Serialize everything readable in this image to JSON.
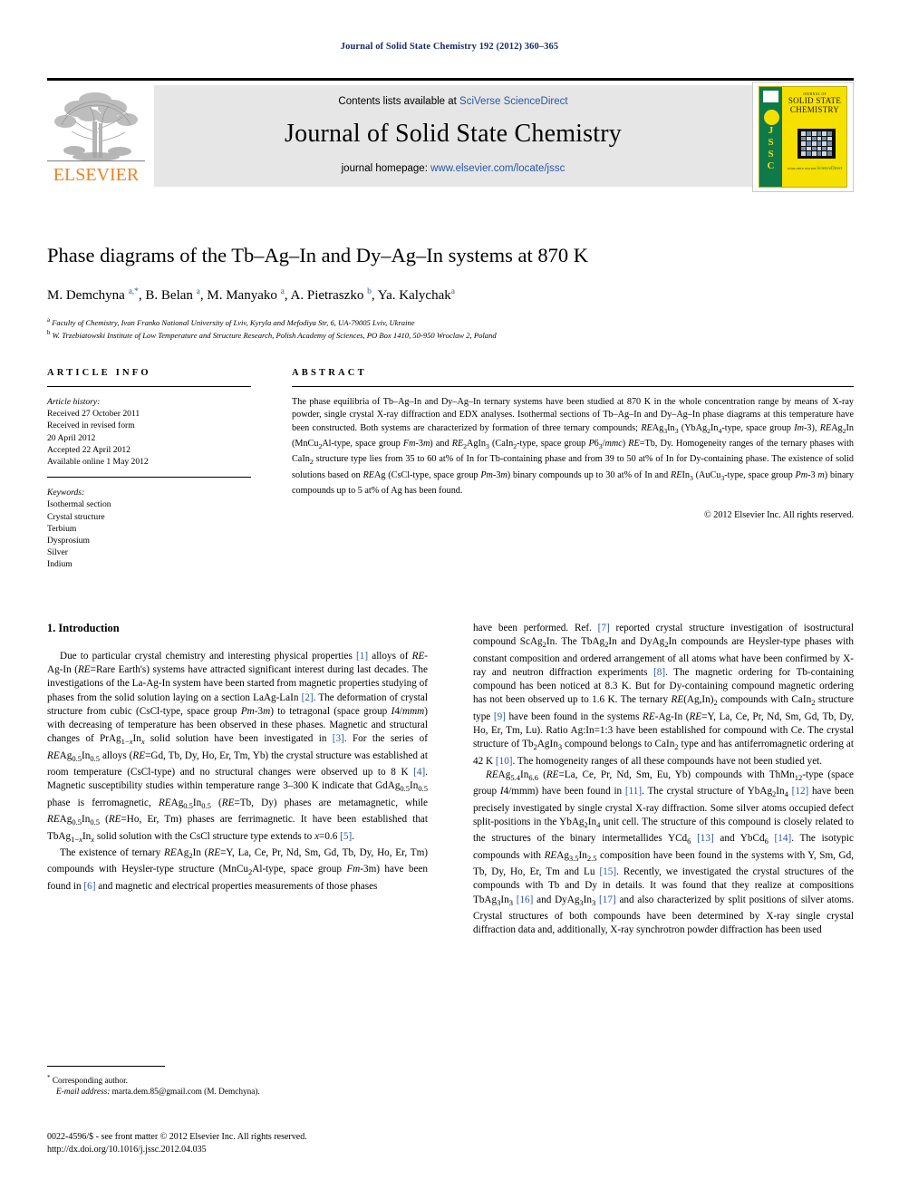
{
  "running_head": "Journal of Solid State Chemistry 192 (2012) 360–365",
  "masthead": {
    "contents_prefix": "Contents lists available at ",
    "contents_link": "SciVerse ScienceDirect",
    "journal_title": "Journal of Solid State Chemistry",
    "homepage_prefix": "journal homepage: ",
    "homepage_link": "www.elsevier.com/locate/jssc",
    "publisher_wordmark": "ELSEVIER"
  },
  "cover": {
    "kicker": "JOURNAL OF",
    "line1": "SOLID STATE",
    "line2": "CHEMISTRY",
    "spine_letters": "J\nS\nS\nC",
    "footer_brand": "ScienceDirect",
    "footer_note": "AVAILABLE ONLINE"
  },
  "article": {
    "title": "Phase diagrams of the Tb–Ag–In and Dy–Ag–In systems at 870 K",
    "authors_html": "M. Demchyna <sup>a,*</sup>, B. Belan <sup>a</sup>, M. Manyako <sup>a</sup>, A. Pietraszko <sup>b</sup>, Ya. Kalychak<sup>a</sup>",
    "affiliation_a": "Faculty of Chemistry, Ivan Franko National University of Lviv, Kyryla and Mefodiya Str, 6, UA-79005 Lviv, Ukraine",
    "affiliation_b": "W. Trzebiatowski Institute of Low Temperature and Structure Research, Polish Academy of Sciences, PO Box 1410, 50-950 Wroclaw 2, Poland"
  },
  "article_info": {
    "heading": "ARTICLE INFO",
    "history_label": "Article history:",
    "history": [
      "Received 27 October 2011",
      "Received in revised form",
      "20 April 2012",
      "Accepted 22 April 2012",
      "Available online 1 May 2012"
    ],
    "keywords_label": "Keywords:",
    "keywords": [
      "Isothermal section",
      "Crystal structure",
      "Terbium",
      "Dysprosium",
      "Silver",
      "Indium"
    ]
  },
  "abstract": {
    "heading": "ABSTRACT",
    "body_html": "The phase equilibria of Tb–Ag–In and Dy–Ag–In ternary systems have been studied at 870 K in the whole concentration range by means of X-ray powder, single crystal X-ray diffraction and EDX analyses. Isothermal sections of Tb–Ag–In and Dy–Ag–In phase diagrams at this temperature have been constructed. Both systems are characterized by formation of three ternary compounds; <i>RE</i>Ag<sub>3</sub>In<sub>3</sub> (YbAg<sub>2</sub>In<sub>4</sub>-type, space group <i>Im</i>-3), <i>RE</i>Ag<sub>2</sub>In (MnCu<sub>2</sub>Al-type, space group <i>Fm</i>-3<i>m</i>) and <i>RE</i><sub>2</sub>AgIn<sub>3</sub> (CaIn<sub>2</sub>-type, space group <i>P</i>6<sub>3</sub>/<i>mmc</i>) <i>RE</i>=Tb, Dy. Homogeneity ranges of the ternary phases with CaIn<sub>2</sub> structure type lies from 35 to 60 at% of In for Tb-containing phase and from 39 to 50 at% of In for Dy-containing phase. The existence of solid solutions based on <i>RE</i>Ag (CsCl-type, space group <i>Pm</i>-3<i>m</i>) binary compounds up to 30 at% of In and <i>RE</i>In<sub>3</sub> (AuCu<sub>3</sub>-type, space group <i>Pm</i>-3 <i>m</i>) binary compounds up to 5 at% of Ag has been found.",
    "copyright": "© 2012 Elsevier Inc. All rights reserved."
  },
  "body": {
    "section_heading": "1.  Introduction",
    "left_paragraphs_html": [
      "Due to particular crystal chemistry and interesting physical properties <span class=\"ref\">[1]</span> alloys of <i>RE</i>-Ag-In (<i>RE</i>=Rare Earth's) systems have attracted significant interest during last decades. The investigations of the La-Ag-In system have been started from magnetic properties studying of phases from the solid solution laying on a section LaAg-LaIn <span class=\"ref\">[2]</span>. The deformation of crystal structure from cubic (CsCl-type, space group <i>Pm</i>-3<i>m</i>) to tetragonal (space group <i>I</i>4/<i>mmm</i>) with decreasing of temperature has been observed in these phases. Magnetic and structural changes of PrAg<sub>1−<i>x</i></sub>In<sub><i>x</i></sub> solid solution have been investigated in <span class=\"ref\">[3]</span>. For the series of <i>RE</i>Ag<sub>0.5</sub>In<sub>0.5</sub> alloys (<i>RE</i>=Gd, Tb, Dy, Ho, Er, Tm, Yb) the crystal structure was established at room temperature (CsCl-type) and no structural changes were observed up to 8 K <span class=\"ref\">[4]</span>. Magnetic susceptibility studies within temperature range 3–300 K indicate that GdAg<sub>0.5</sub>In<sub>0.5</sub> phase is ferromagnetic, <i>RE</i>Ag<sub>0.5</sub>In<sub>0.5</sub> (<i>RE</i>=Tb, Dy) phases are metamagnetic, while <i>RE</i>Ag<sub>0.5</sub>In<sub>0.5</sub> (<i>RE</i>=Ho, Er, Tm) phases are ferrimagnetic. It have been established that TbAg<sub>1−<i>x</i></sub>In<sub><i>x</i></sub> solid solution with the CsCl structure type extends to <i>x</i>=0.6 <span class=\"ref\">[5]</span>.",
      "The existence of ternary <i>RE</i>Ag<sub>2</sub>In (<i>RE</i>=Y, La, Ce, Pr, Nd, Sm, Gd, Tb, Dy, Ho, Er, Tm) compounds with Heysler-type structure (MnCu<sub>2</sub>Al-type, space group <i>Fm</i>-3m) have been found in <span class=\"ref\">[6]</span> and magnetic and electrical properties measurements of those phases"
    ],
    "right_paragraphs_html": [
      "have been performed. Ref. <span class=\"ref\">[7]</span> reported crystal structure investigation of isostructural compound ScAg<sub>2</sub>In. The TbAg<sub>2</sub>In and DyAg<sub>2</sub>In compounds are Heysler-type phases with constant composition and ordered arrangement of all atoms what have been confirmed by X-ray and neutron diffraction experiments <span class=\"ref\">[8]</span>. The magnetic ordering for Tb-containing compound has been noticed at 8.3 K. But for Dy-containing compound magnetic ordering has not been observed up to 1.6 K. The ternary <i>RE</i>(Ag,In)<sub>2</sub> compounds with CaIn<sub>2</sub> structure type <span class=\"ref\">[9]</span> have been found in the systems <i>RE</i>-Ag-In (<i>RE</i>=Y, La, Ce, Pr, Nd, Sm, Gd, Tb, Dy, Ho, Er, Tm, Lu). Ratio Ag:In=1:3 have been established for compound with Ce. The crystal structure of Tb<sub>2</sub>AgIn<sub>3</sub> compound belongs to CaIn<sub>2</sub> type and has antiferromagnetic ordering at 42 K <span class=\"ref\">[10]</span>. The homogeneity ranges of all these compounds have not been studied yet.",
      "<i>RE</i>Ag<sub>5.4</sub>In<sub>6.6</sub> (<i>RE</i>=La, Ce, Pr, Nd, Sm, Eu, Yb) compounds with ThMn<sub>12</sub>-type (space group <i>I</i>4/mmm) have been found in <span class=\"ref\">[11]</span>. The crystal structure of YbAg<sub>2</sub>In<sub>4</sub> <span class=\"ref\">[12]</span> have been precisely investigated by single crystal X-ray diffraction. Some silver atoms occupied defect split-positions in the YbAg<sub>2</sub>In<sub>4</sub> unit cell. The structure of this compound is closely related to the structures of the binary intermetallides YCd<sub>6</sub> <span class=\"ref\">[13]</span> and YbCd<sub>6</sub> <span class=\"ref\">[14]</span>. The isotypic compounds with <i>RE</i>Ag<sub>3.5</sub>In<sub>2.5</sub> composition have been found in the systems with Y, Sm, Gd, Tb, Dy, Ho, Er, Tm and Lu <span class=\"ref\">[15]</span>. Recently, we investigated the crystal structures of the compounds with Tb and Dy in details. It was found that they realize at compositions TbAg<sub>3</sub>In<sub>3</sub> <span class=\"ref\">[16]</span> and DyAg<sub>3</sub>In<sub>3</sub> <span class=\"ref\">[17]</span> and also characterized by split positions of silver atoms. Crystal structures of both compounds have been determined by X-ray single crystal diffraction data and, additionally, X-ray synchrotron powder diffraction has been used"
    ]
  },
  "footnotes": {
    "corresponding": "Corresponding author.",
    "email_label": "E-mail address:",
    "email": "marta.dem.85@gmail.com (M. Demchyna)."
  },
  "imprint": {
    "line1": "0022-4596/$ - see front matter © 2012 Elsevier Inc. All rights reserved.",
    "line2": "http://dx.doi.org/10.1016/j.jssc.2012.04.035"
  }
}
